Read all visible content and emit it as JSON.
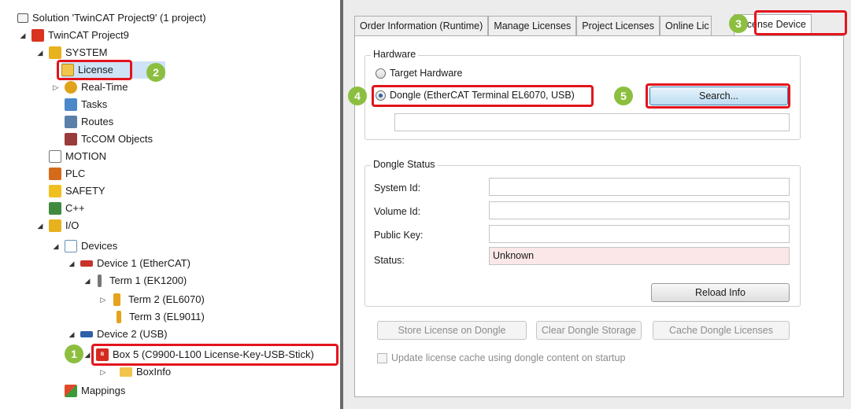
{
  "explorer": {
    "items": [
      {
        "label": "Solution 'TwinCAT Project9' (1 project)",
        "icon": "solution-icon"
      },
      {
        "label": "TwinCAT Project9",
        "icon": "twincat-project-icon"
      },
      {
        "label": "SYSTEM",
        "icon": "system-icon"
      },
      {
        "label": "License",
        "icon": "license-icon"
      },
      {
        "label": "Real-Time",
        "icon": "realtime-icon"
      },
      {
        "label": "Tasks",
        "icon": "tasks-icon"
      },
      {
        "label": "Routes",
        "icon": "routes-icon"
      },
      {
        "label": "TcCOM Objects",
        "icon": "tccom-icon"
      },
      {
        "label": "MOTION",
        "icon": "motion-icon"
      },
      {
        "label": "PLC",
        "icon": "plc-icon"
      },
      {
        "label": "SAFETY",
        "icon": "safety-icon"
      },
      {
        "label": "C++",
        "icon": "cpp-icon"
      },
      {
        "label": "I/O",
        "icon": "io-icon"
      },
      {
        "label": "Devices",
        "icon": "devices-icon"
      },
      {
        "label": "Device 1 (EtherCAT)",
        "icon": "ethercat-device-icon"
      },
      {
        "label": "Term 1 (EK1200)",
        "icon": "terminal-icon"
      },
      {
        "label": "Term 2 (EL6070)",
        "icon": "terminal-icon"
      },
      {
        "label": "Term 3 (EL9011)",
        "icon": "terminal-end-icon"
      },
      {
        "label": "Device 2 (USB)",
        "icon": "usb-device-icon"
      },
      {
        "label": "Box 5 (C9900-L100 License-Key-USB-Stick)",
        "icon": "beckhoff-box-icon"
      },
      {
        "label": "BoxInfo",
        "icon": "folder-icon"
      },
      {
        "label": "Mappings",
        "icon": "mappings-icon"
      }
    ]
  },
  "tabs": [
    {
      "label": "Order Information (Runtime)"
    },
    {
      "label": "Manage Licenses"
    },
    {
      "label": "Project Licenses"
    },
    {
      "label": "Online Lic"
    },
    {
      "label": "License Device"
    }
  ],
  "hardware": {
    "title": "Hardware",
    "option_target": "Target Hardware",
    "option_dongle": "Dongle (EtherCAT Terminal EL6070, USB)",
    "selected": "Dongle (EtherCAT Terminal EL6070, USB)",
    "search_button": "Search...",
    "dongle_path": ""
  },
  "dongle_status": {
    "title": "Dongle Status",
    "system_id_label": "System Id:",
    "system_id_value": "",
    "volume_id_label": "Volume Id:",
    "volume_id_value": "",
    "public_key_label": "Public Key:",
    "public_key_value": "",
    "status_label": "Status:",
    "status_value": "Unknown",
    "reload_button": "Reload Info"
  },
  "actions": {
    "store": "Store License on Dongle",
    "clear": "Clear Dongle Storage",
    "cache": "Cache Dongle Licenses",
    "checkbox_label": "Update license cache using dongle content on startup",
    "checkbox_checked": false
  },
  "callouts": [
    "1",
    "2",
    "3",
    "4",
    "5"
  ],
  "colors": {
    "highlight": "#e3141c",
    "badge": "#8cbf3f",
    "status_warn_bg": "#fbe7e7"
  }
}
